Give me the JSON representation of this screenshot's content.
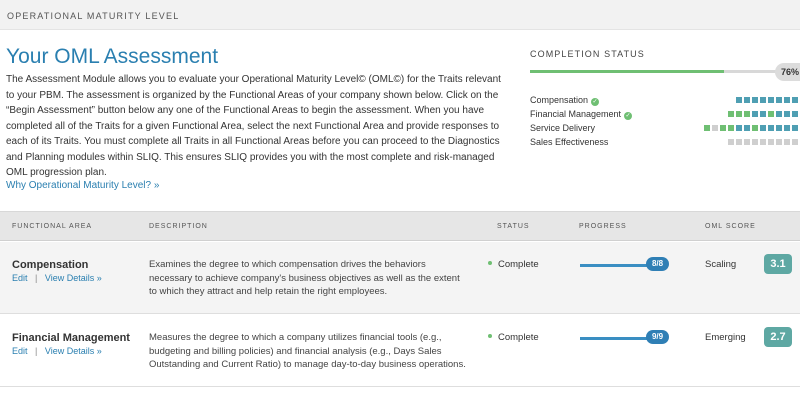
{
  "header": {
    "breadcrumb": "OPERATIONAL MATURITY LEVEL"
  },
  "main": {
    "title": "Your OML Assessment",
    "intro": "The Assessment Module allows you to evaluate your Operational Maturity Level© (OML©) for the Traits relevant to your PBM. The assessment is organized by the Functional Areas of your company shown below. Click on the “Begin Assessment” button below any one of the Functional Areas to begin the assessment. When you have completed all of the Traits for a given Functional Area, select the next Functional Area and provide responses to each of its Traits. You must complete all Traits in all Functional Areas before you can proceed to the Diagnostics and Planning modules within SLIQ. This ensures SLIQ provides you with the most complete and risk-managed OML progression plan.",
    "why_link": "Why Operational Maturity Level? »"
  },
  "completion": {
    "heading": "COMPLETION STATUS",
    "percent_value": 0.76,
    "percent_label": "76%",
    "colors": {
      "green": "#6fbf73",
      "teal": "#4f9fb3",
      "gray": "#cfcfcf"
    },
    "areas": [
      {
        "label": "Compensation",
        "complete": true,
        "squares": [
          "teal",
          "teal",
          "teal",
          "teal",
          "teal",
          "teal",
          "teal",
          "teal"
        ]
      },
      {
        "label": "Financial Management",
        "complete": true,
        "squares": [
          "green",
          "green",
          "green",
          "teal",
          "teal",
          "green",
          "teal",
          "teal",
          "teal"
        ]
      },
      {
        "label": "Service Delivery",
        "complete": false,
        "squares": [
          "green",
          "gray",
          "green",
          "green",
          "teal",
          "teal",
          "green",
          "teal",
          "teal",
          "teal",
          "teal",
          "teal"
        ]
      },
      {
        "label": "Sales Effectiveness",
        "complete": false,
        "squares": [
          "gray",
          "gray",
          "gray",
          "gray",
          "gray",
          "gray",
          "gray",
          "gray",
          "gray"
        ]
      }
    ]
  },
  "table": {
    "headers": {
      "area": "FUNCTIONAL AREA",
      "description": "DESCRIPTION",
      "status": "STATUS",
      "progress": "PROGRESS",
      "score": "OML SCORE"
    },
    "edit_label": "Edit",
    "separator": "|",
    "view_label": "View Details »",
    "rows": [
      {
        "name": "Compensation",
        "description": "Examines the degree to which compensation drives the behaviors necessary to achieve company's business objectives as well as the extent to which they attract and help retain the right employees.",
        "status": "Complete",
        "progress": "8/8",
        "score_label": "Scaling",
        "score": "3.1"
      },
      {
        "name": "Financial Management",
        "description": "Measures the degree to which a company utilizes financial tools (e.g., budgeting and billing policies) and financial analysis (e.g., Days Sales Outstanding and Current Ratio) to manage day-to-day business operations.",
        "status": "Complete",
        "progress": "9/9",
        "score_label": "Emerging",
        "score": "2.7"
      }
    ]
  }
}
